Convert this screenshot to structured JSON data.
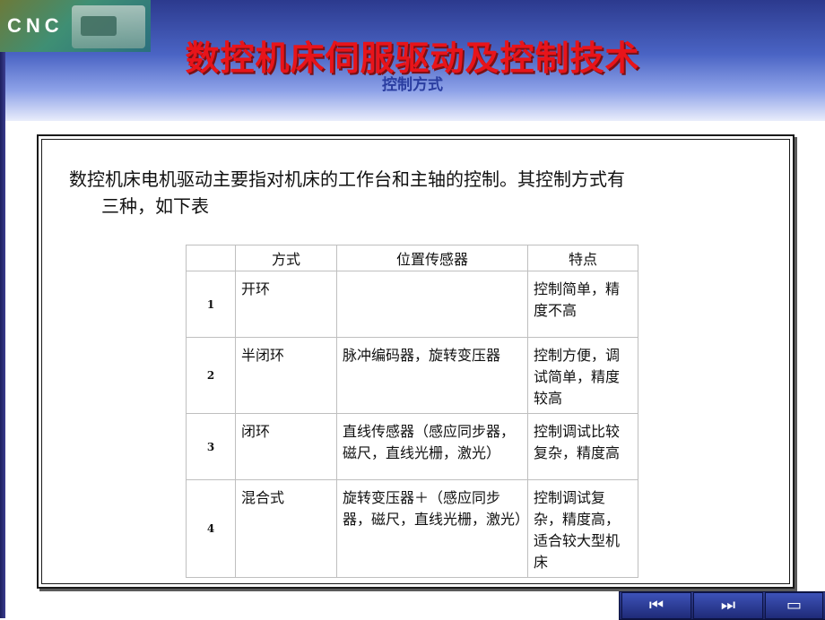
{
  "logo": {
    "text": "CNC"
  },
  "title": "数控机床伺服驱动及控制技术",
  "subtitle": "控制方式",
  "intro": {
    "line1": "数控机床电机驱动主要指对机床的工作台和主轴的控制。其控制方式有",
    "line2": "三种，如下表"
  },
  "table": {
    "headers": [
      "",
      "方式",
      "位置传感器",
      "特点"
    ],
    "rows": [
      {
        "no": "1",
        "mode": "开环",
        "sensor": "",
        "feature": "控制简单，精度不高"
      },
      {
        "no": "2",
        "mode": "半闭环",
        "sensor": "脉冲编码器，旋转变压器",
        "feature": "控制方便，调试简单，精度较高"
      },
      {
        "no": "3",
        "mode": "闭环",
        "sensor": "直线传感器（感应同步器，磁尺，直线光栅，激光）",
        "feature": "控制调试比较复杂，精度高"
      },
      {
        "no": "4",
        "mode": "混合式",
        "sensor": "旋转变压器＋（感应同步器，磁尺，直线光栅，激光）",
        "feature": "控制调试复杂，精度高，适合较大型机床"
      }
    ]
  },
  "nav": {
    "first_icon": "skip-back-icon",
    "last_icon": "skip-forward-icon",
    "return_icon": "return-icon",
    "first_glyph": "⏮",
    "last_glyph": "⏭",
    "return_glyph": "▭"
  },
  "colors": {
    "title": "#e8141a",
    "subtitle": "#2a3da0",
    "header_band": "#4a64c4"
  }
}
